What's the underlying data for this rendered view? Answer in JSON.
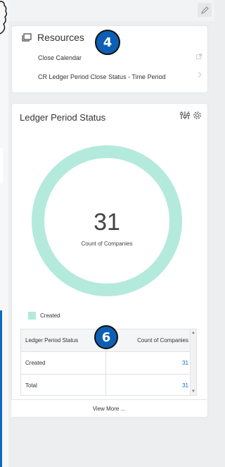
{
  "resources": {
    "title": "Resources",
    "badge": "4",
    "links": [
      {
        "label": "Close Calendar",
        "icon": "external-link-icon"
      },
      {
        "label": "CR Ledger Period Close Status - Time Period",
        "icon": "chevron-right-icon"
      }
    ]
  },
  "ledger": {
    "title": "Ledger Period Status",
    "badge": "6",
    "donut": {
      "value": "31",
      "label": "Count of Companies",
      "color": "#b3eadc"
    },
    "legend": [
      {
        "label": "Created",
        "color": "#b3eadc"
      }
    ],
    "table": {
      "headers": [
        "Ledger Period Status",
        "Count of Companies"
      ],
      "rows": [
        {
          "status": "Created",
          "count": "31"
        },
        {
          "status": "Total",
          "count": "31"
        }
      ]
    },
    "view_more": "View More ..."
  },
  "colors": {
    "accent": "#0a6bc4",
    "badge": "#0c5fb5",
    "donut": "#b3eadc"
  }
}
